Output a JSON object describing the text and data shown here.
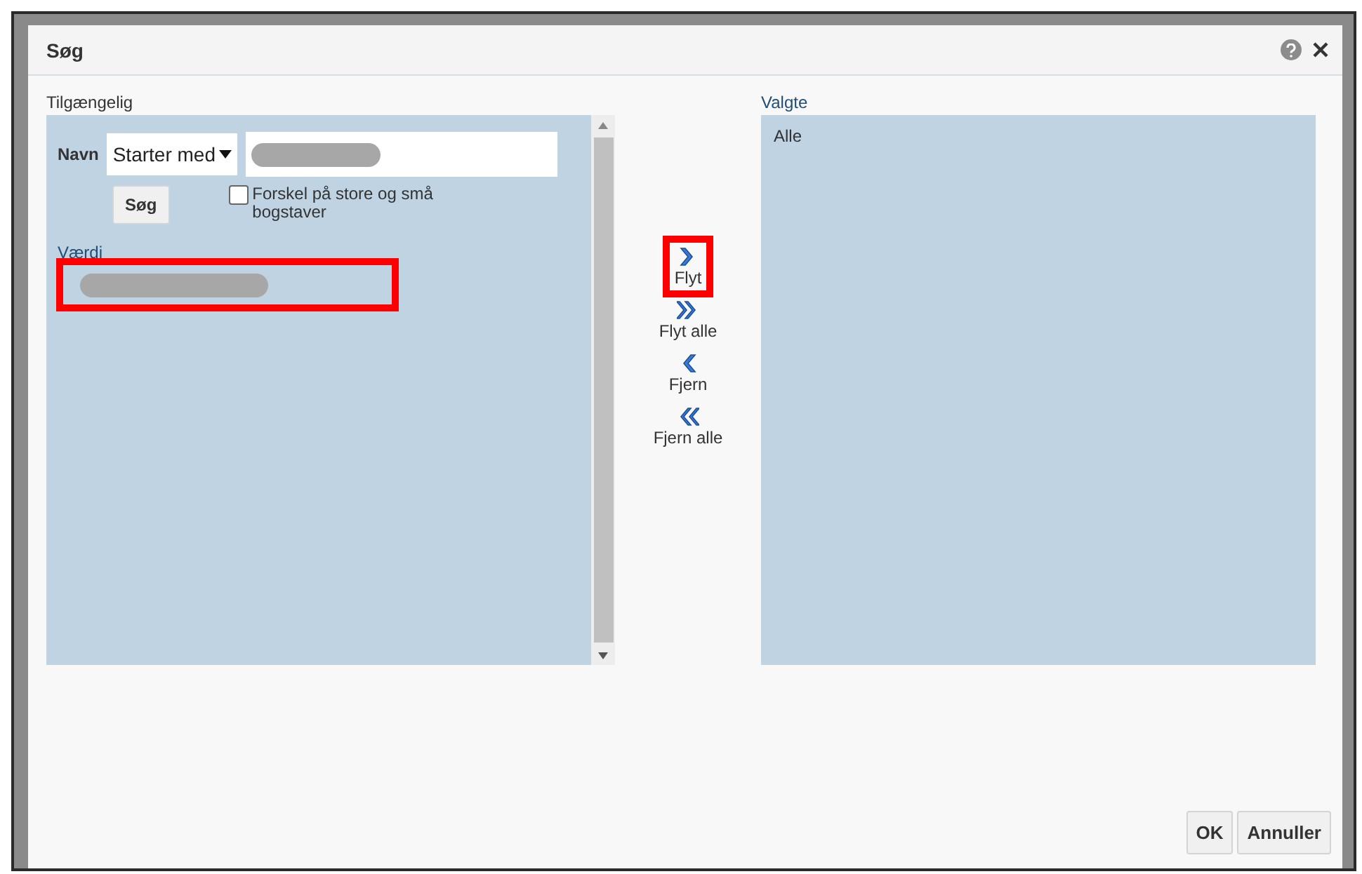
{
  "dialog": {
    "title": "Søg"
  },
  "available": {
    "label": "Tilgængelig",
    "name_label": "Navn",
    "operator": "Starter med",
    "search_button": "Søg",
    "case_sensitive": {
      "label": "Forskel på store og små bogstaver",
      "checked": false
    },
    "value_header": "Værdi",
    "values": [
      {
        "highlighted": true
      }
    ]
  },
  "shuttle": [
    {
      "kind": "move",
      "label": "Flyt",
      "highlighted": true
    },
    {
      "kind": "move_all",
      "label": "Flyt alle",
      "highlighted": false
    },
    {
      "kind": "remove",
      "label": "Fjern",
      "highlighted": false
    },
    {
      "kind": "remove_all",
      "label": "Fjern alle",
      "highlighted": false
    }
  ],
  "selected": {
    "label": "Valgte",
    "items": [
      "Alle"
    ]
  },
  "buttons": [
    "OK",
    "Annuller"
  ]
}
